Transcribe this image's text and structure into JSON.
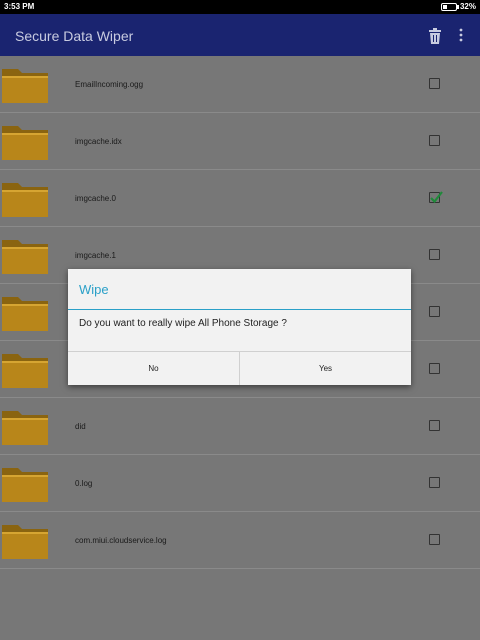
{
  "status_bar": {
    "time": "3:53 PM",
    "battery_percent": "32%",
    "battery_level": 0.32
  },
  "app_bar": {
    "title": "Secure Data Wiper",
    "icons": [
      "trash-icon",
      "overflow-menu-icon"
    ],
    "color": "#1a2470"
  },
  "file_list": [
    {
      "name": "EmailIncoming.ogg",
      "checked": false
    },
    {
      "name": "imgcache.idx",
      "checked": false
    },
    {
      "name": "imgcache.0",
      "checked": true
    },
    {
      "name": "imgcache.1",
      "checked": false
    },
    {
      "name": "",
      "checked": false
    },
    {
      "name": "",
      "checked": false
    },
    {
      "name": "did",
      "checked": false
    },
    {
      "name": "0.log",
      "checked": false
    },
    {
      "name": "com.miui.cloudservice.log",
      "checked": false
    }
  ],
  "dialog": {
    "title": "Wipe",
    "message": "Do you want to really wipe All Phone Storage ?",
    "no_label": "No",
    "yes_label": "Yes",
    "accent_color": "#2aa0c8"
  },
  "colors": {
    "check_accent": "#1f8a3a",
    "folder": "#b8861a"
  }
}
